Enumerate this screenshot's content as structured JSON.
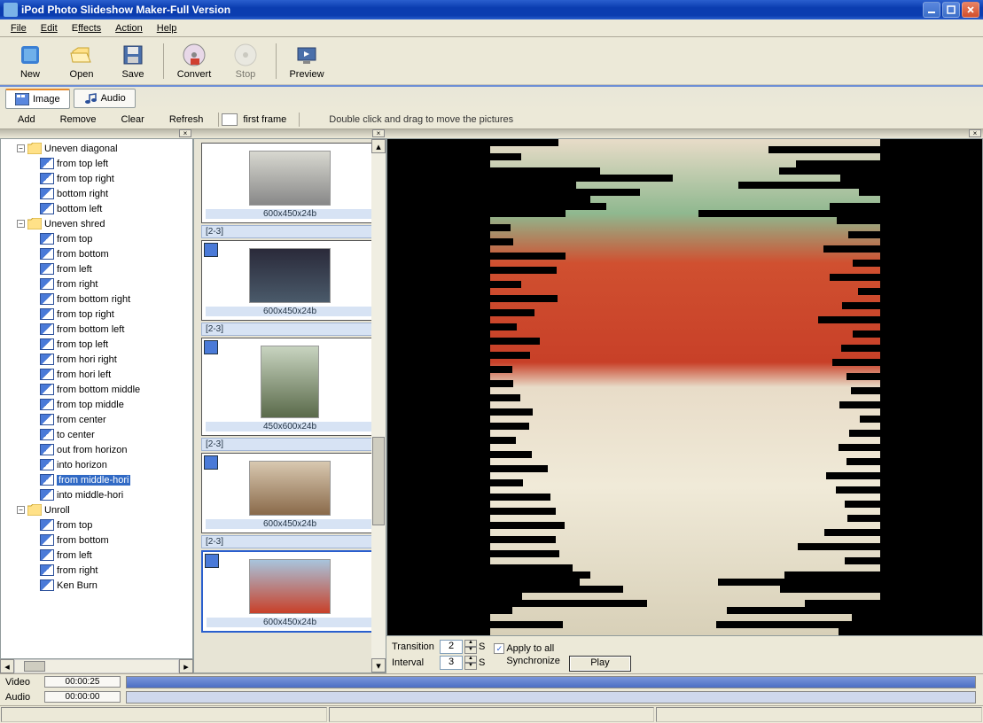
{
  "window": {
    "title": "iPod Photo Slideshow Maker-Full Version"
  },
  "menu": {
    "file": "File",
    "edit": "Edit",
    "effects": "Effects",
    "action": "Action",
    "help": "Help"
  },
  "toolbar": {
    "new": "New",
    "open": "Open",
    "save": "Save",
    "convert": "Convert",
    "stop": "Stop",
    "preview": "Preview"
  },
  "tabs": {
    "image": "Image",
    "audio": "Audio"
  },
  "actions": {
    "add": "Add",
    "remove": "Remove",
    "clear": "Clear",
    "refresh": "Refresh",
    "first_frame": "first frame",
    "hint": "Double click and drag to move the pictures"
  },
  "tree": {
    "groups": [
      {
        "label": "Uneven diagonal",
        "children": [
          "from top left",
          "from top right",
          "bottom right",
          "bottom left"
        ]
      },
      {
        "label": "Uneven shred",
        "children": [
          "from top",
          "from bottom",
          "from left",
          "from right",
          "from bottom right",
          "from top right",
          "from bottom left",
          "from top left",
          "from hori right",
          "from hori left",
          "from bottom middle",
          "from top middle",
          "from center",
          "to center",
          "out from horizon",
          "into horizon",
          "from middle-hori",
          "into middle-hori"
        ],
        "selected": "from middle-hori"
      },
      {
        "label": "Unroll",
        "children": [
          "from top",
          "from bottom",
          "from left",
          "from right",
          "Ken Burn"
        ]
      }
    ]
  },
  "thumbs": [
    {
      "range": "",
      "dim": "600x450x24b",
      "port": false
    },
    {
      "range": "[2-3]",
      "dim": "600x450x24b",
      "port": false
    },
    {
      "range": "[2-3]",
      "dim": "450x600x24b",
      "port": true
    },
    {
      "range": "[2-3]",
      "dim": "600x450x24b",
      "port": false
    },
    {
      "range": "[2-3]",
      "dim": "600x450x24b",
      "port": false,
      "selected": true
    }
  ],
  "controls": {
    "transition_label": "Transition",
    "transition_val": "2",
    "unit": "S",
    "interval_label": "Interval",
    "interval_val": "3",
    "apply_all": "Apply to all",
    "apply_checked": true,
    "sync": "Synchronize",
    "play": "Play"
  },
  "timeline": {
    "video_label": "Video",
    "video_time": "00:00:25",
    "audio_label": "Audio",
    "audio_time": "00:00:00"
  }
}
